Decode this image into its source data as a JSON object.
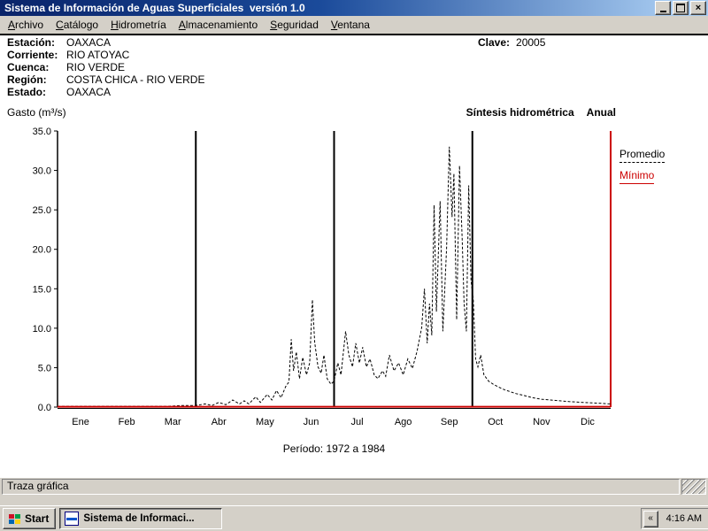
{
  "colors": {
    "titlebar_left": "#0a246a",
    "titlebar_right": "#a6caf0",
    "window_face": "#d4d0c8",
    "promedio_line": "#000000",
    "minimo_line": "#cc0000"
  },
  "window": {
    "title": "Sistema de Información de Aguas Superficiales  versión 1.0"
  },
  "menu": {
    "items": [
      {
        "label": "Archivo"
      },
      {
        "label": "Catálogo"
      },
      {
        "label": "Hidrometría"
      },
      {
        "label": "Almacenamiento"
      },
      {
        "label": "Seguridad"
      },
      {
        "label": "Ventana"
      }
    ]
  },
  "station_info": {
    "fields": [
      {
        "label": "Estación:",
        "value": "OAXACA"
      },
      {
        "label": "Corriente:",
        "value": "RIO ATOYAC"
      },
      {
        "label": "Cuenca:",
        "value": "RIO VERDE"
      },
      {
        "label": "Región:",
        "value": "COSTA CHICA - RIO VERDE"
      },
      {
        "label": "Estado:",
        "value": "OAXACA"
      }
    ],
    "clave_label": "Clave:",
    "clave_value": "20005"
  },
  "chart": {
    "y_axis_title": "Gasto (m³/s)",
    "subtitle": "Síntesis hidrométrica",
    "subtitle_mode": "Anual",
    "period_label": "Período: 1972 a 1984"
  },
  "chart_data": {
    "type": "line",
    "title": "Síntesis hidrométrica Anual",
    "xlabel": "Período: 1972 a 1984",
    "ylabel": "Gasto (m³/s)",
    "ylim": [
      0,
      35
    ],
    "ytick_step": 5,
    "x_units": "months (x = fraction of year, 0 = start Ene, 12 = end Dic)",
    "x_categories": [
      "Ene",
      "Feb",
      "Mar",
      "Abr",
      "May",
      "Jun",
      "Jul",
      "Ago",
      "Sep",
      "Oct",
      "Nov",
      "Dic"
    ],
    "quarter_lines_x": [
      3,
      6,
      9
    ],
    "frame_right_color": "#cc0000",
    "grid": false,
    "legend_position": "right",
    "series": [
      {
        "name": "Promedio",
        "color": "#000000",
        "style": "dashed",
        "points": [
          [
            0,
            0.1
          ],
          [
            0.3,
            0.1
          ],
          [
            0.6,
            0.1
          ],
          [
            0.9,
            0.1
          ],
          [
            1.2,
            0.1
          ],
          [
            1.5,
            0.1
          ],
          [
            1.8,
            0.1
          ],
          [
            2.1,
            0.1
          ],
          [
            2.4,
            0.1
          ],
          [
            2.7,
            0.2
          ],
          [
            3,
            0.2
          ],
          [
            3.2,
            0.4
          ],
          [
            3.35,
            0.2
          ],
          [
            3.5,
            0.6
          ],
          [
            3.65,
            0.3
          ],
          [
            3.8,
            0.9
          ],
          [
            3.95,
            0.4
          ],
          [
            4.05,
            0.8
          ],
          [
            4.15,
            0.4
          ],
          [
            4.3,
            1.3
          ],
          [
            4.4,
            0.6
          ],
          [
            4.55,
            1.6
          ],
          [
            4.65,
            0.9
          ],
          [
            4.75,
            2.1
          ],
          [
            4.85,
            1.2
          ],
          [
            4.95,
            2.6
          ],
          [
            5.02,
            3.2
          ],
          [
            5.07,
            8.6
          ],
          [
            5.12,
            4.6
          ],
          [
            5.18,
            7.0
          ],
          [
            5.25,
            3.6
          ],
          [
            5.32,
            6.3
          ],
          [
            5.4,
            4.1
          ],
          [
            5.47,
            5.6
          ],
          [
            5.53,
            13.6
          ],
          [
            5.58,
            8.2
          ],
          [
            5.65,
            5.1
          ],
          [
            5.72,
            4.3
          ],
          [
            5.78,
            6.6
          ],
          [
            5.85,
            3.6
          ],
          [
            5.93,
            2.9
          ],
          [
            6.0,
            3.3
          ],
          [
            6.08,
            5.6
          ],
          [
            6.15,
            4.1
          ],
          [
            6.25,
            9.6
          ],
          [
            6.32,
            6.6
          ],
          [
            6.4,
            5.1
          ],
          [
            6.47,
            8.1
          ],
          [
            6.55,
            5.6
          ],
          [
            6.62,
            7.6
          ],
          [
            6.7,
            5.1
          ],
          [
            6.78,
            6.1
          ],
          [
            6.87,
            4.1
          ],
          [
            6.95,
            3.6
          ],
          [
            7.05,
            4.6
          ],
          [
            7.12,
            3.9
          ],
          [
            7.2,
            6.6
          ],
          [
            7.3,
            4.6
          ],
          [
            7.4,
            5.6
          ],
          [
            7.5,
            4.1
          ],
          [
            7.6,
            6.1
          ],
          [
            7.7,
            4.9
          ],
          [
            7.8,
            7.1
          ],
          [
            7.9,
            10.1
          ],
          [
            7.96,
            15.0
          ],
          [
            8.02,
            8.1
          ],
          [
            8.07,
            13.1
          ],
          [
            8.12,
            9.1
          ],
          [
            8.17,
            25.6
          ],
          [
            8.22,
            12.1
          ],
          [
            8.3,
            26.1
          ],
          [
            8.36,
            9.6
          ],
          [
            8.44,
            20.1
          ],
          [
            8.5,
            33.0
          ],
          [
            8.56,
            24.1
          ],
          [
            8.6,
            29.6
          ],
          [
            8.66,
            11.1
          ],
          [
            8.72,
            30.6
          ],
          [
            8.78,
            21.1
          ],
          [
            8.82,
            13.1
          ],
          [
            8.87,
            9.6
          ],
          [
            8.92,
            28.1
          ],
          [
            8.97,
            16.1
          ],
          [
            9.02,
            13.6
          ],
          [
            9.07,
            6.1
          ],
          [
            9.12,
            5.1
          ],
          [
            9.18,
            6.6
          ],
          [
            9.25,
            4.1
          ],
          [
            9.35,
            3.3
          ],
          [
            9.45,
            2.9
          ],
          [
            9.55,
            2.6
          ],
          [
            9.65,
            2.3
          ],
          [
            9.75,
            2.1
          ],
          [
            9.85,
            1.9
          ],
          [
            9.95,
            1.7
          ],
          [
            10.1,
            1.5
          ],
          [
            10.3,
            1.2
          ],
          [
            10.5,
            1.0
          ],
          [
            10.7,
            0.9
          ],
          [
            10.9,
            0.8
          ],
          [
            11.1,
            0.7
          ],
          [
            11.4,
            0.6
          ],
          [
            11.7,
            0.5
          ],
          [
            12,
            0.4
          ]
        ]
      },
      {
        "name": "Mínimo",
        "color": "#cc0000",
        "style": "solid",
        "points": [
          [
            0,
            0.05
          ],
          [
            12,
            0.05
          ]
        ]
      }
    ]
  },
  "statusbar": {
    "text": "Traza gráfica"
  },
  "taskbar": {
    "start_label": "Start",
    "task_label": "Sistema de Informaci...",
    "tray_toggle": "«",
    "clock": "4:16 AM"
  }
}
